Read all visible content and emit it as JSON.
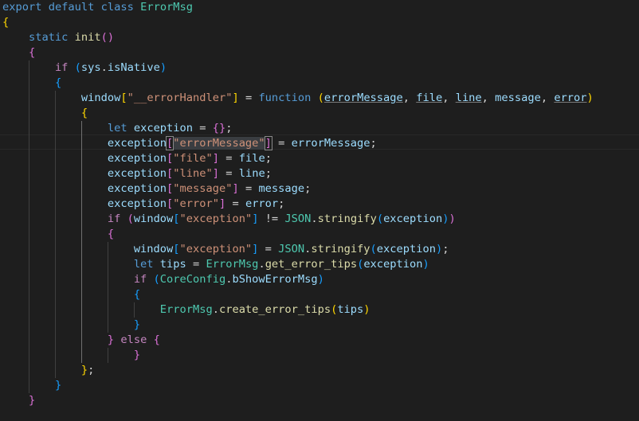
{
  "editor": {
    "language": "javascript",
    "theme_colors": {
      "background": "#1e1e1e",
      "keyword": "#569cd6",
      "control": "#c586c0",
      "class": "#4ec9b0",
      "function": "#dcdcaa",
      "variable": "#9cdcfe",
      "string": "#ce9178",
      "bracket_gold": "#ffd700",
      "bracket_orchid": "#da70d6",
      "bracket_blue": "#179fff"
    },
    "current_line": 10,
    "lines": [
      {
        "t": [
          [
            "export",
            "kw"
          ],
          [
            " ",
            ""
          ],
          [
            "default",
            "kw"
          ],
          [
            " ",
            ""
          ],
          [
            "class",
            "kw"
          ],
          [
            " ",
            ""
          ],
          [
            "ErrorMsg",
            "cls"
          ]
        ]
      },
      {
        "t": [
          [
            "{",
            "b1"
          ]
        ]
      },
      {
        "t": [
          [
            "    ",
            ""
          ],
          [
            "static",
            "kw"
          ],
          [
            " ",
            ""
          ],
          [
            "init",
            "fn"
          ],
          [
            "()",
            "b2"
          ]
        ]
      },
      {
        "t": [
          [
            "    ",
            ""
          ],
          [
            "{",
            "b2"
          ]
        ]
      },
      {
        "t": [
          [
            "        ",
            ""
          ],
          [
            "if",
            "ctl"
          ],
          [
            " ",
            ""
          ],
          [
            "(",
            "b3"
          ],
          [
            "sys",
            "var"
          ],
          [
            ".",
            ""
          ],
          [
            "isNative",
            "var"
          ],
          [
            ")",
            "b3"
          ]
        ]
      },
      {
        "t": [
          [
            "        ",
            ""
          ],
          [
            "{",
            "b3"
          ]
        ]
      },
      {
        "t": [
          [
            "            ",
            ""
          ],
          [
            "window",
            "var"
          ],
          [
            "[",
            "b1"
          ],
          [
            "\"__errorHandler\"",
            "str"
          ],
          [
            "]",
            "b1"
          ],
          [
            " = ",
            ""
          ],
          [
            "function",
            "kw"
          ],
          [
            " ",
            ""
          ],
          [
            "(",
            "b1"
          ],
          [
            "errorMessage",
            "var u"
          ],
          [
            ", ",
            ""
          ],
          [
            "file",
            "var u"
          ],
          [
            ", ",
            ""
          ],
          [
            "line",
            "var u"
          ],
          [
            ", ",
            ""
          ],
          [
            "message",
            "var"
          ],
          [
            ", ",
            ""
          ],
          [
            "error",
            "var u"
          ],
          [
            ")",
            "b1"
          ]
        ]
      },
      {
        "t": [
          [
            "            ",
            ""
          ],
          [
            "{",
            "b1"
          ]
        ]
      },
      {
        "t": [
          [
            "                ",
            ""
          ],
          [
            "let",
            "kw"
          ],
          [
            " ",
            ""
          ],
          [
            "exception",
            "var"
          ],
          [
            " = ",
            ""
          ],
          [
            "{}",
            "b2"
          ],
          [
            ";",
            ""
          ]
        ]
      },
      {
        "t": [
          [
            "                ",
            ""
          ],
          [
            "exception",
            "var"
          ],
          [
            "[",
            "b2 bm"
          ],
          [
            "\"errorMess",
            "str hl"
          ],
          [
            "",
            "cursor"
          ],
          [
            "age\"",
            "str hl"
          ],
          [
            "]",
            "b2 bm"
          ],
          [
            " = ",
            ""
          ],
          [
            "errorMessage",
            "var"
          ],
          [
            ";",
            ""
          ]
        ]
      },
      {
        "t": [
          [
            "                ",
            ""
          ],
          [
            "exception",
            "var"
          ],
          [
            "[",
            "b2"
          ],
          [
            "\"file\"",
            "str"
          ],
          [
            "]",
            "b2"
          ],
          [
            " = ",
            ""
          ],
          [
            "file",
            "var"
          ],
          [
            ";",
            ""
          ]
        ]
      },
      {
        "t": [
          [
            "                ",
            ""
          ],
          [
            "exception",
            "var"
          ],
          [
            "[",
            "b2"
          ],
          [
            "\"line\"",
            "str"
          ],
          [
            "]",
            "b2"
          ],
          [
            " = ",
            ""
          ],
          [
            "line",
            "var"
          ],
          [
            ";",
            ""
          ]
        ]
      },
      {
        "t": [
          [
            "                ",
            ""
          ],
          [
            "exception",
            "var"
          ],
          [
            "[",
            "b2"
          ],
          [
            "\"message\"",
            "str"
          ],
          [
            "]",
            "b2"
          ],
          [
            " = ",
            ""
          ],
          [
            "message",
            "var"
          ],
          [
            ";",
            ""
          ]
        ]
      },
      {
        "t": [
          [
            "                ",
            ""
          ],
          [
            "exception",
            "var"
          ],
          [
            "[",
            "b2"
          ],
          [
            "\"error\"",
            "str"
          ],
          [
            "]",
            "b2"
          ],
          [
            " = ",
            ""
          ],
          [
            "error",
            "var"
          ],
          [
            ";",
            ""
          ]
        ]
      },
      {
        "t": [
          [
            "                ",
            ""
          ],
          [
            "if",
            "ctl"
          ],
          [
            " ",
            ""
          ],
          [
            "(",
            "b2"
          ],
          [
            "window",
            "var"
          ],
          [
            "[",
            "b3"
          ],
          [
            "\"exception\"",
            "str"
          ],
          [
            "]",
            "b3"
          ],
          [
            " != ",
            ""
          ],
          [
            "JSON",
            "cls"
          ],
          [
            ".",
            ""
          ],
          [
            "stringify",
            "fn"
          ],
          [
            "(",
            "b3"
          ],
          [
            "exception",
            "var"
          ],
          [
            ")",
            "b3"
          ],
          [
            ")",
            "b2"
          ]
        ]
      },
      {
        "t": [
          [
            "                ",
            ""
          ],
          [
            "{",
            "b2"
          ]
        ]
      },
      {
        "t": [
          [
            "                    ",
            ""
          ],
          [
            "window",
            "var"
          ],
          [
            "[",
            "b3"
          ],
          [
            "\"exception\"",
            "str"
          ],
          [
            "]",
            "b3"
          ],
          [
            " = ",
            ""
          ],
          [
            "JSON",
            "cls"
          ],
          [
            ".",
            ""
          ],
          [
            "stringify",
            "fn"
          ],
          [
            "(",
            "b3"
          ],
          [
            "exception",
            "var"
          ],
          [
            ")",
            "b3"
          ],
          [
            ";",
            ""
          ]
        ]
      },
      {
        "t": [
          [
            "                    ",
            ""
          ],
          [
            "let",
            "kw"
          ],
          [
            " ",
            ""
          ],
          [
            "tips",
            "var"
          ],
          [
            " = ",
            ""
          ],
          [
            "ErrorMsg",
            "cls"
          ],
          [
            ".",
            ""
          ],
          [
            "get_error_tips",
            "fn"
          ],
          [
            "(",
            "b3"
          ],
          [
            "exception",
            "var"
          ],
          [
            ")",
            "b3"
          ]
        ]
      },
      {
        "t": [
          [
            "                    ",
            ""
          ],
          [
            "if",
            "ctl"
          ],
          [
            " ",
            ""
          ],
          [
            "(",
            "b3"
          ],
          [
            "CoreConfig",
            "cls"
          ],
          [
            ".",
            ""
          ],
          [
            "bShowErrorMsg",
            "var"
          ],
          [
            ")",
            "b3"
          ]
        ]
      },
      {
        "t": [
          [
            "                    ",
            ""
          ],
          [
            "{",
            "b3"
          ]
        ]
      },
      {
        "t": [
          [
            "                        ",
            ""
          ],
          [
            "ErrorMsg",
            "cls"
          ],
          [
            ".",
            ""
          ],
          [
            "create_error_tips",
            "fn"
          ],
          [
            "(",
            "b1"
          ],
          [
            "tips",
            "var"
          ],
          [
            ")",
            "b1"
          ]
        ]
      },
      {
        "t": [
          [
            "                    ",
            ""
          ],
          [
            "}",
            "b3"
          ]
        ]
      },
      {
        "t": [
          [
            "                ",
            ""
          ],
          [
            "}",
            "b2"
          ],
          [
            " ",
            ""
          ],
          [
            "else",
            "ctl"
          ],
          [
            " ",
            ""
          ],
          [
            "{",
            "b2"
          ]
        ]
      },
      {
        "t": [
          [
            "                    ",
            ""
          ],
          [
            "}",
            "b2"
          ]
        ]
      },
      {
        "t": [
          [
            "            ",
            ""
          ],
          [
            "}",
            "b1"
          ],
          [
            ";",
            ""
          ]
        ]
      },
      {
        "t": [
          [
            "        ",
            ""
          ],
          [
            "}",
            "b3"
          ]
        ]
      },
      {
        "t": [
          [
            "    ",
            ""
          ],
          [
            "}",
            "b2"
          ]
        ]
      }
    ]
  }
}
